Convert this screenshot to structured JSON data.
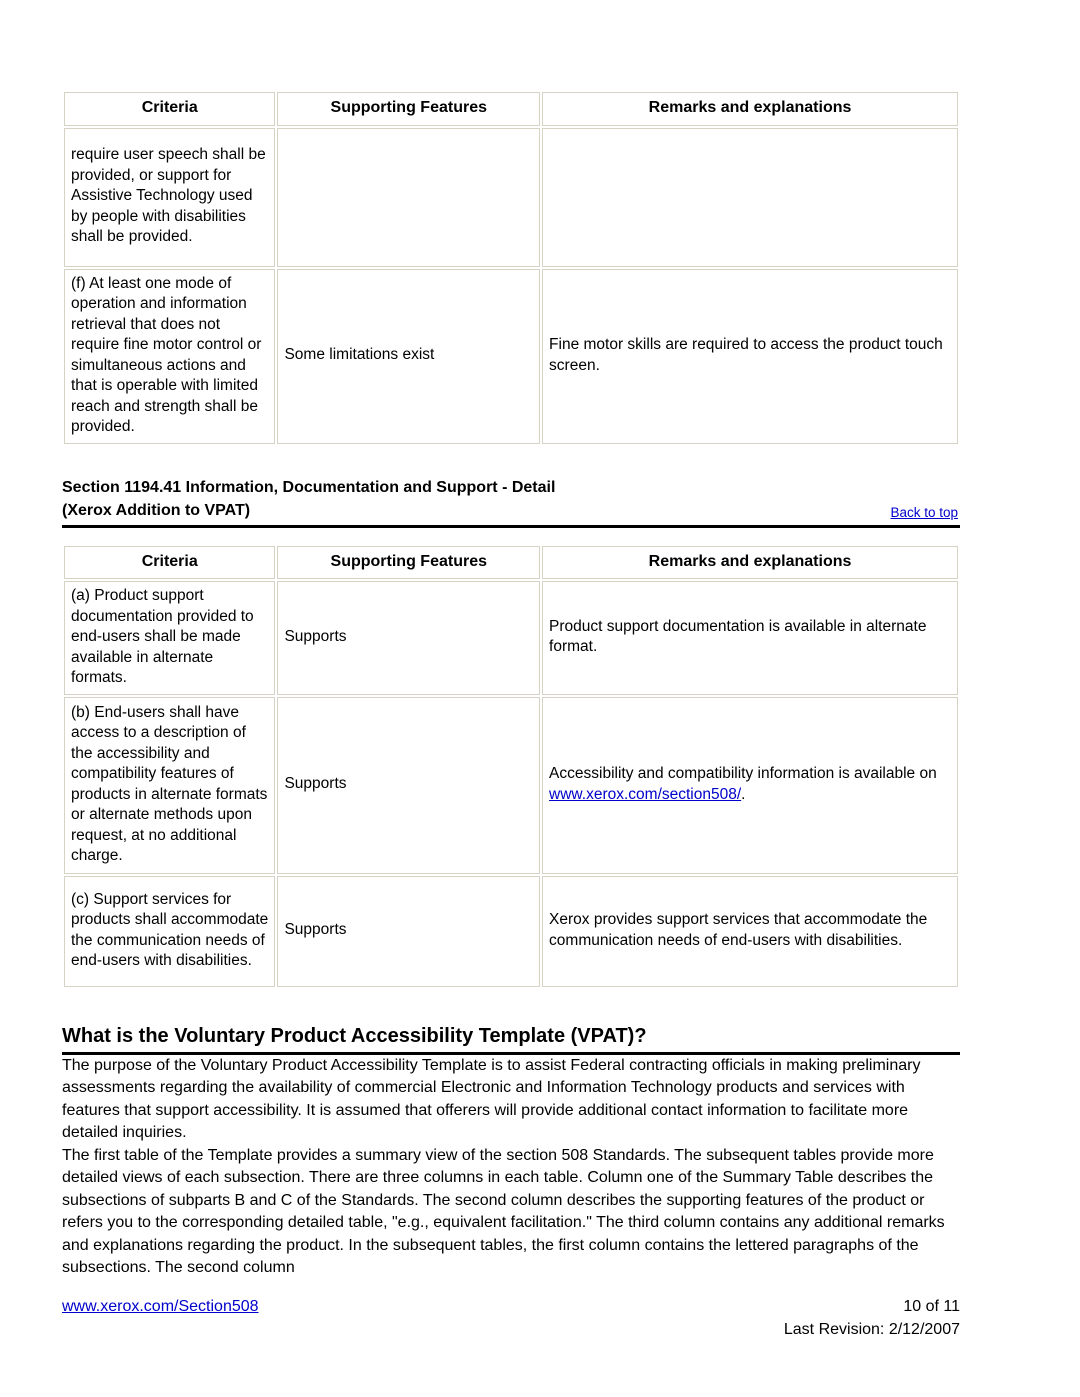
{
  "document": {
    "table_headers": {
      "criteria": "Criteria",
      "supporting_features": "Supporting Features",
      "remarks": "Remarks and explanations"
    },
    "table_top": {
      "rows": [
        {
          "criteria": "require user speech shall be provided, or support for Assistive Technology used by people with disabilities shall be provided.",
          "supporting_features": "",
          "remarks": ""
        },
        {
          "criteria": "(f) At least one mode of operation and information retrieval that does not require fine motor control or simultaneous actions and that is operable with limited reach and strength shall be provided.",
          "supporting_features": "Some limitations exist",
          "remarks": "Fine motor skills are required to access the product touch screen."
        }
      ]
    },
    "section_heading": {
      "line1": "Section 1194.41 Information, Documentation and Support - Detail",
      "line2": "(Xerox Addition to VPAT)",
      "back_to_top": "Back to top"
    },
    "table_detail": {
      "rows": [
        {
          "criteria": "(a) Product support documentation provided to end-users shall be made available in alternate formats.",
          "supporting_features": "Supports",
          "remarks_before": "Product support documentation is available in alternate format.",
          "remarks_link": "",
          "remarks_after": ""
        },
        {
          "criteria": "(b) End-users shall have access to a description of the accessibility and compatibility features of products in alternate formats or alternate methods upon request, at no additional charge.",
          "supporting_features": "Supports",
          "remarks_before": "Accessibility and compatibility information is available on ",
          "remarks_link": "www.xerox.com/section508/",
          "remarks_after": "."
        },
        {
          "criteria": "(c) Support services for products shall accommodate the communication needs of end-users with disabilities.",
          "supporting_features": "Supports",
          "remarks_before": "Xerox provides support services that accommodate the communication needs of end-users with disabilities.",
          "remarks_link": "",
          "remarks_after": ""
        }
      ]
    },
    "vpat_section": {
      "heading": "What is the Voluntary Product Accessibility Template (VPAT)?",
      "paragraph1": "The purpose of the Voluntary Product Accessibility Template is to assist Federal contracting officials in making preliminary assessments regarding the availability of commercial Electronic and Information Technology products and services with features that support accessibility. It is assumed that offerers will provide additional contact information to facilitate more detailed inquiries.",
      "paragraph2": "The first table of the Template provides a summary view of the section 508 Standards. The subsequent tables provide more detailed views of each subsection. There are three columns in each table. Column one of the Summary Table describes the subsections of subparts B and C of the Standards. The second column describes the supporting features of the product or refers you to the corresponding detailed table, \"e.g., equivalent facilitation.\" The third column contains any additional remarks and explanations regarding the product. In the subsequent tables, the first column contains the lettered paragraphs of the subsections. The second column"
    },
    "footer": {
      "url": "www.xerox.com/Section508",
      "page_number": "10 of 11",
      "last_revision": "Last Revision: 2/12/2007"
    },
    "colors": {
      "link": "#0000cc",
      "table_border": "#d6d2c4",
      "rule": "#000000"
    }
  }
}
